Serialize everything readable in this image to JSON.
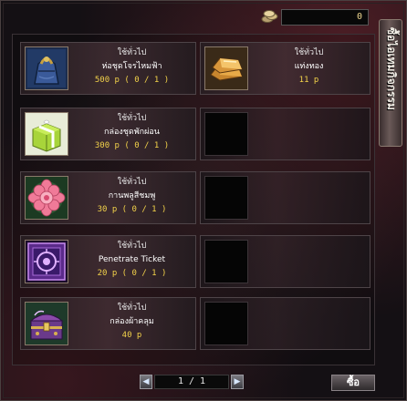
{
  "header": {
    "gold_amount": "0"
  },
  "side_tab": {
    "label": "ซื้อไอเทมกิจกรรม"
  },
  "items": [
    {
      "category": "ใช้ทั่วไป",
      "name": "ห่อชุดโจรไหมฟ้า",
      "price": "500 p  ( 0 / 1 )",
      "icon": "blue-bundle-icon"
    },
    {
      "category": "ใช้ทั่วไป",
      "name": "แท่งทอง",
      "price": "11 p",
      "icon": "gold-bars-icon"
    },
    {
      "category": "ใช้ทั่วไป",
      "name": "กล่องชุดพักผ่อน",
      "price": "300 p  ( 0 / 1 )",
      "icon": "gift-box-icon"
    },
    {
      "category": "ใช้ทั่วไป",
      "name": "กานพลูสีชมพู",
      "price": "30 p  ( 0 / 1 )",
      "icon": "pink-flower-icon"
    },
    {
      "category": "ใช้ทั่วไป",
      "name": "Penetrate Ticket",
      "price": "20 p  ( 0 / 1 )",
      "icon": "purple-ticket-icon"
    },
    {
      "category": "ใช้ทั่วไป",
      "name": "กล่องผ้าคลุม",
      "price": "40 p",
      "icon": "treasure-chest-icon"
    }
  ],
  "pager": {
    "prev_icon": "prev-arrow-icon",
    "next_icon": "next-arrow-icon",
    "page_text": "1 / 1"
  },
  "buy_button": {
    "label": "ซื้อ"
  }
}
